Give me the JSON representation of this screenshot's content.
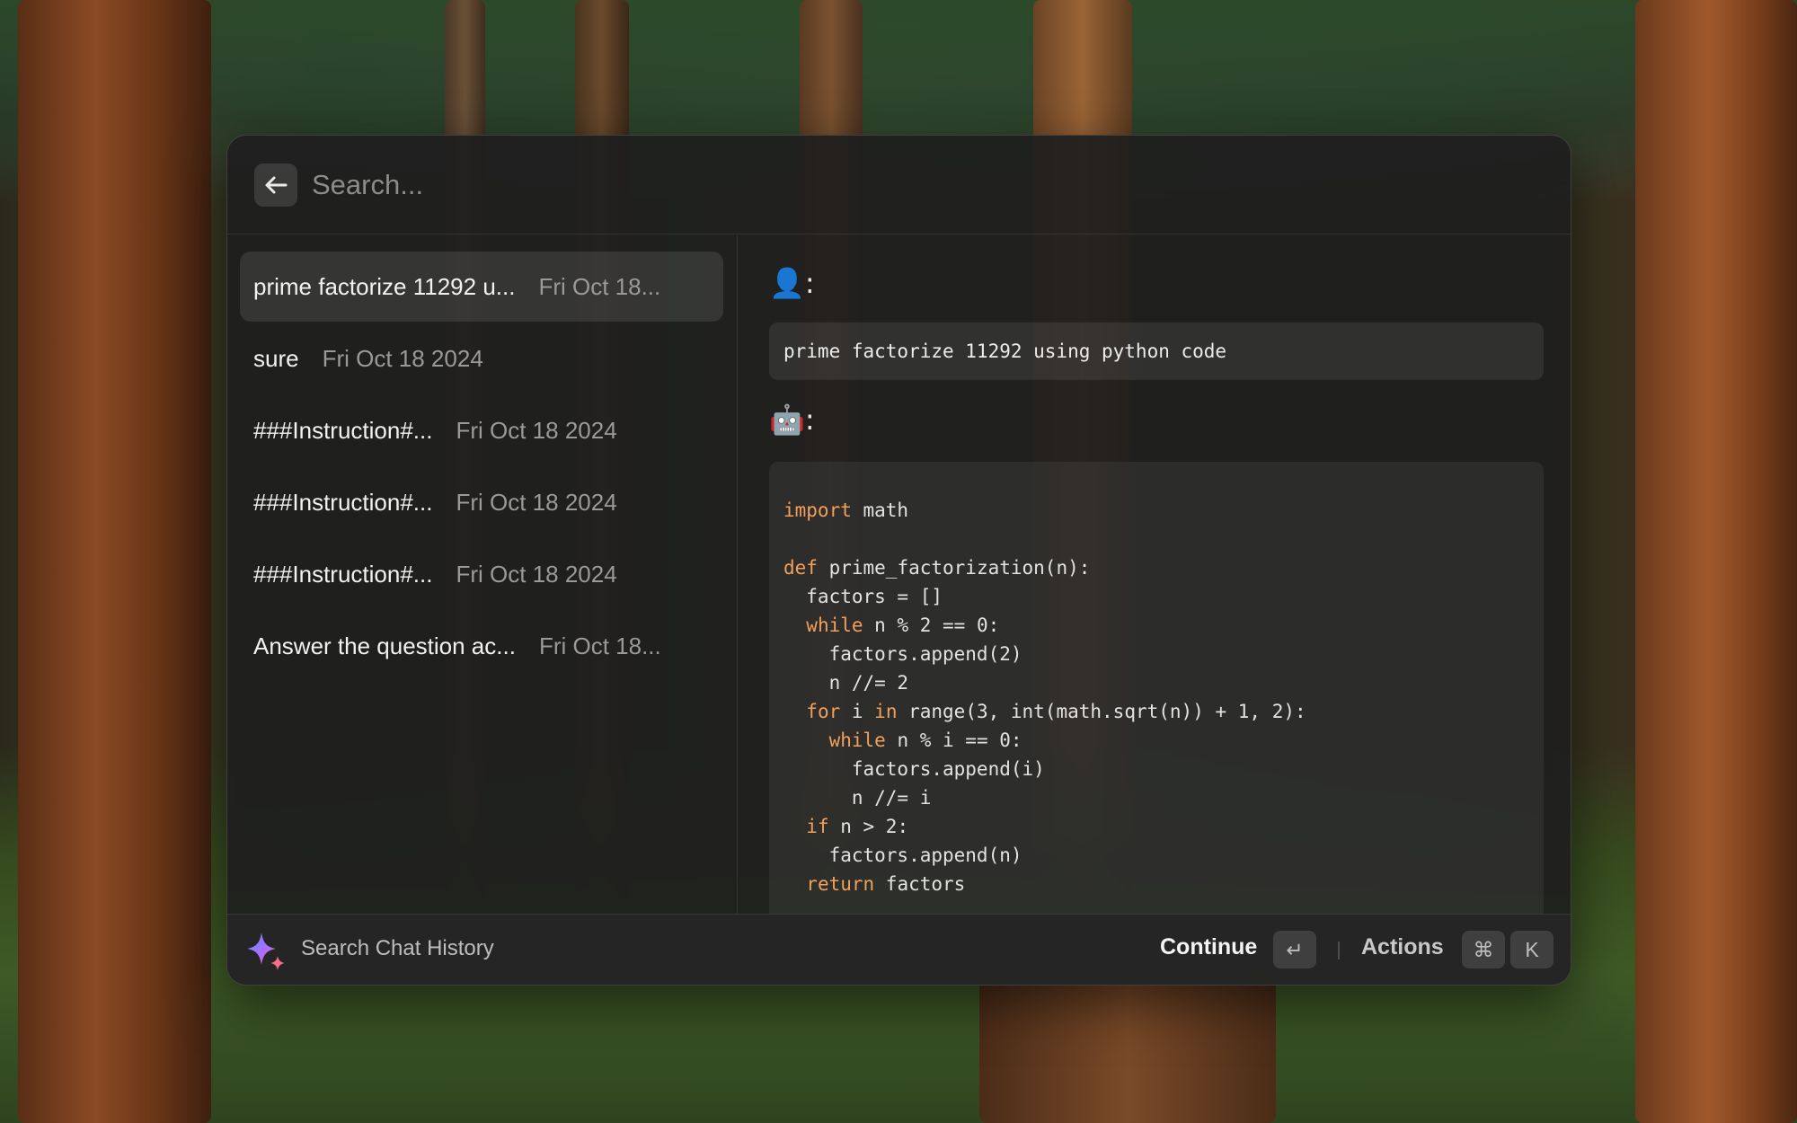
{
  "search": {
    "placeholder": "Search..."
  },
  "history": [
    {
      "title": "prime factorize 11292 u...",
      "date": "Fri Oct 18..."
    },
    {
      "title": "sure",
      "date": "Fri Oct 18 2024"
    },
    {
      "title": "###Instruction#...",
      "date": "Fri Oct 18 2024"
    },
    {
      "title": "###Instruction#...",
      "date": "Fri Oct 18 2024"
    },
    {
      "title": "###Instruction#...",
      "date": "Fri Oct 18 2024"
    },
    {
      "title": "Answer the question ac...",
      "date": "Fri Oct 18..."
    }
  ],
  "detail": {
    "user_label": "👤:",
    "user_message": "prime factorize 11292 using python code",
    "assistant_label": "🤖:",
    "code_lines": [
      "import math",
      "",
      "def prime_factorization(n):",
      "  factors = []",
      "  while n % 2 == 0:",
      "    factors.append(2)",
      "    n //= 2",
      "  for i in range(3, int(math.sqrt(n)) + 1, 2):",
      "    while n % i == 0:",
      "      factors.append(i)",
      "      n //= i",
      "  if n > 2:",
      "    factors.append(n)",
      "  return factors"
    ]
  },
  "footer": {
    "title": "Search Chat History",
    "continue_label": "Continue",
    "continue_key": "↵",
    "actions_label": "Actions",
    "actions_keys": [
      "⌘",
      "K"
    ]
  },
  "colors": {
    "keyword": "#f0a05a",
    "window_bg": "#1e1e1e",
    "selected_bg": "#3a3a3a"
  },
  "icons": {
    "back": "arrow-left-icon",
    "footer": "sparkle-icon"
  }
}
